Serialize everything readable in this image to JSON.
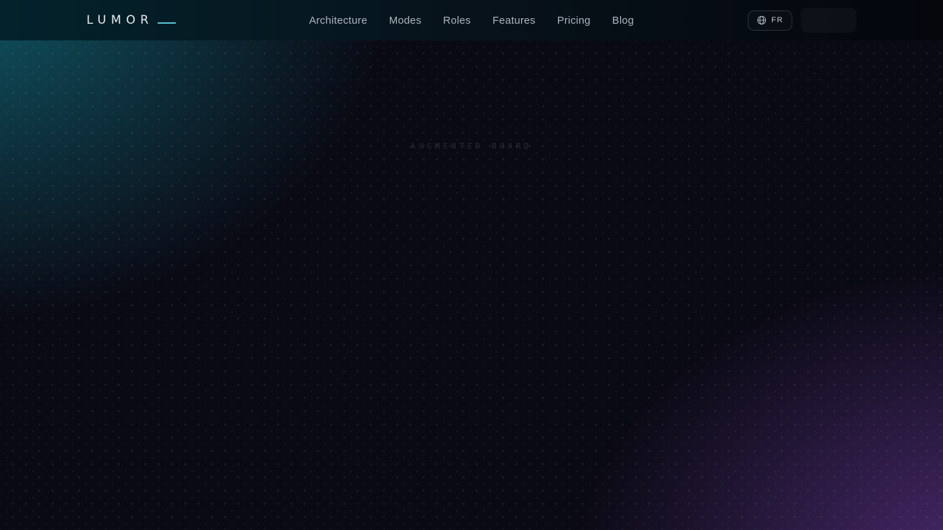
{
  "brand": {
    "name": "LUMOR"
  },
  "nav": {
    "items": [
      {
        "label": "Architecture"
      },
      {
        "label": "Modes"
      },
      {
        "label": "Roles"
      },
      {
        "label": "Features"
      },
      {
        "label": "Pricing"
      },
      {
        "label": "Blog"
      }
    ]
  },
  "header": {
    "language_label": "FR",
    "cta_label": ""
  },
  "hero": {
    "watermark": "AUGMENTED BOARD"
  },
  "icons": {
    "globe": "globe-icon",
    "brand_dash": "brand-dash-icon"
  },
  "colors": {
    "accent_teal": "#59c6d6",
    "glow_teal": "#105c6a",
    "glow_purple": "#56307e",
    "base_background": "#0a0a14",
    "header_gradient_left": "#03222b",
    "header_gradient_right": "#04060c",
    "nav_text": "#aeb6bf",
    "logo_text": "#e8ecef",
    "watermark_text": "rgba(130,170,205,0.22)"
  }
}
